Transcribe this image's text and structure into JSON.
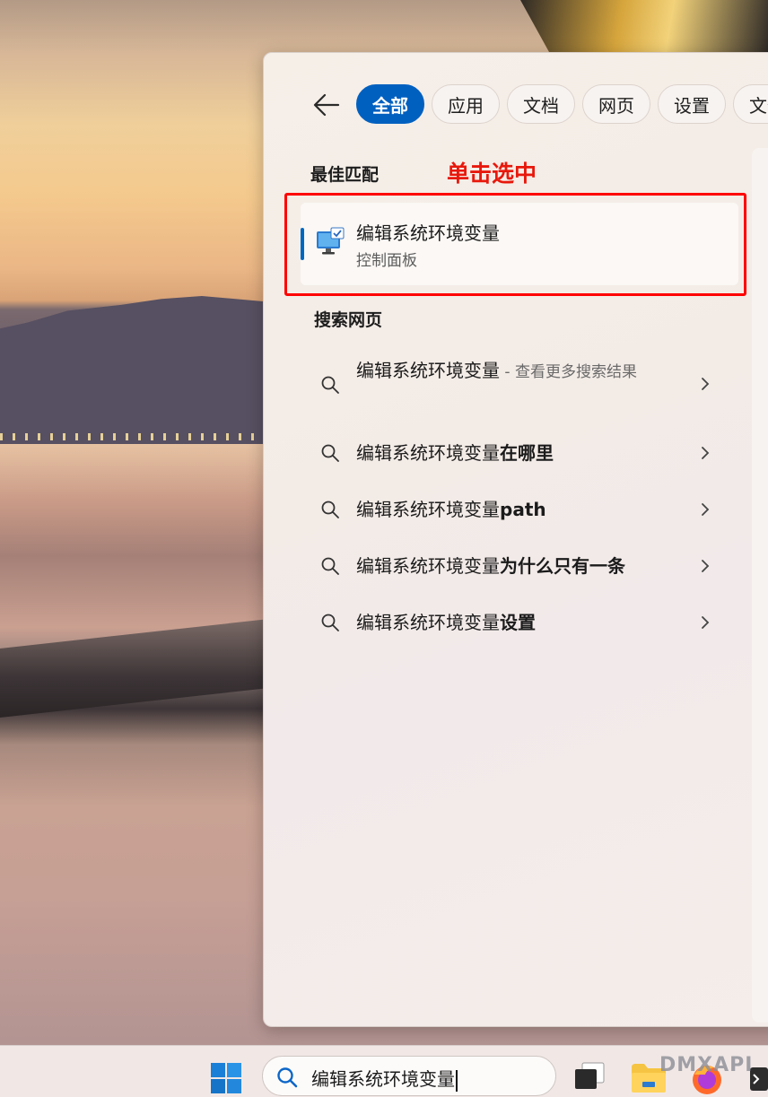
{
  "tabs": [
    {
      "label": "全部",
      "active": true
    },
    {
      "label": "应用",
      "active": false
    },
    {
      "label": "文档",
      "active": false
    },
    {
      "label": "网页",
      "active": false
    },
    {
      "label": "设置",
      "active": false
    },
    {
      "label": "文件",
      "active": false
    }
  ],
  "best_match": {
    "heading": "最佳匹配",
    "annotation": "单击选中",
    "item": {
      "title": "编辑系统环境变量",
      "subtitle": "控制面板",
      "icon": "control-panel-monitor-icon"
    }
  },
  "web_search": {
    "heading": "搜索网页",
    "items": [
      {
        "query": "编辑系统环境变量",
        "bold_suffix": "",
        "hint": " - 查看更多搜索结果"
      },
      {
        "query": "编辑系统环境变量",
        "bold_suffix": "在哪里",
        "hint": ""
      },
      {
        "query": "编辑系统环境变量",
        "bold_suffix": "path",
        "hint": ""
      },
      {
        "query": "编辑系统环境变量",
        "bold_suffix": "为什么只有一条",
        "hint": ""
      },
      {
        "query": "编辑系统环境变量",
        "bold_suffix": "设置",
        "hint": ""
      }
    ]
  },
  "taskbar": {
    "search_value": "编辑系统环境变量",
    "watermark": "DMXAPI"
  },
  "colors": {
    "accent": "#0060c0",
    "annotation_red": "#e8180c"
  }
}
